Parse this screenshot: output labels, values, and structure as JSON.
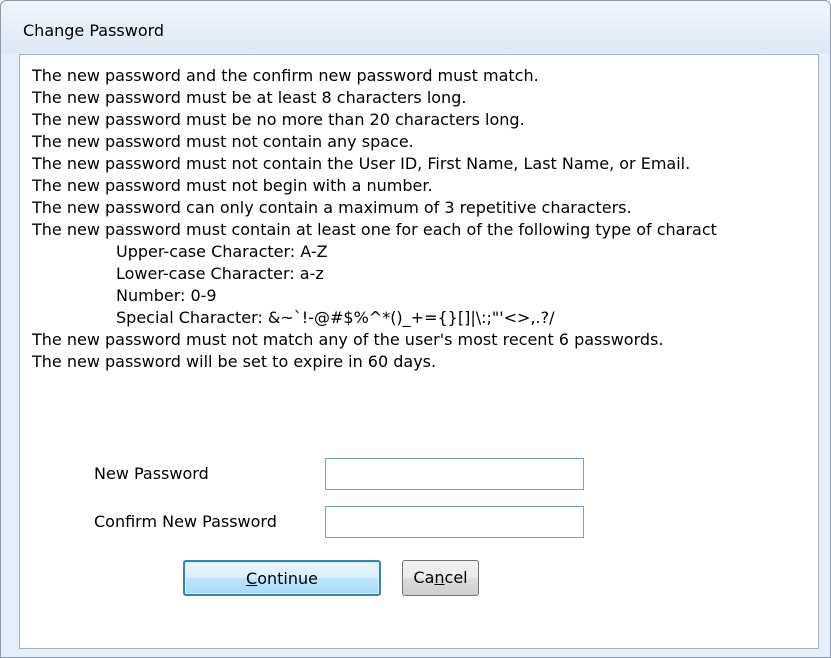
{
  "window": {
    "title": "Change Password"
  },
  "rules": [
    {
      "text": "The new password and the confirm new password must match.",
      "indent": false
    },
    {
      "text": "The new password must be at least 8 characters long.",
      "indent": false
    },
    {
      "text": "The new password must be no more than 20 characters long.",
      "indent": false
    },
    {
      "text": "The new password must not contain any space.",
      "indent": false
    },
    {
      "text": "The new password must not contain the User ID, First Name, Last Name, or Email.",
      "indent": false
    },
    {
      "text": "The new password must not begin with a number.",
      "indent": false
    },
    {
      "text": "The new password can only contain a maximum of 3 repetitive characters.",
      "indent": false
    },
    {
      "text": "The new password must contain at least one for each of the following type of charact",
      "indent": false
    },
    {
      "text": "Upper-case Character: A-Z",
      "indent": true
    },
    {
      "text": "Lower-case Character: a-z",
      "indent": true
    },
    {
      "text": "Number: 0-9",
      "indent": true
    },
    {
      "text": "Special Character: &~`!-@#$%^*()_+={}[]|\\:;\"'<>,.?/",
      "indent": true
    },
    {
      "text": "The new password must not match any of the user's most recent 6 passwords.",
      "indent": false
    },
    {
      "text": "The new password will be set to expire in 60 days.",
      "indent": false
    }
  ],
  "form": {
    "new_password_label": "New Password",
    "new_password_value": "",
    "confirm_password_label": "Confirm New Password",
    "confirm_password_value": ""
  },
  "buttons": {
    "continue": {
      "label_accel": "C",
      "label_rest": "ontinue"
    },
    "cancel": {
      "label_pre": "Ca",
      "label_accel": "n",
      "label_rest": "cel"
    }
  }
}
